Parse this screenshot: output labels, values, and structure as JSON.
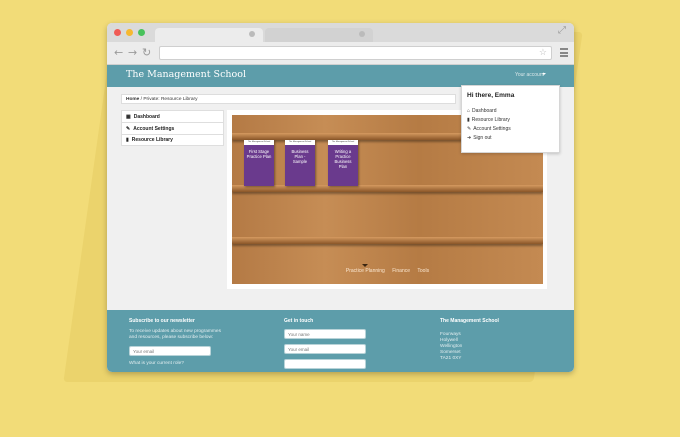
{
  "site": {
    "brand": "The Management School",
    "account_label": "Your account"
  },
  "breadcrumb": {
    "home": "Home",
    "separator": "/",
    "current": "Private: Resource Library"
  },
  "sidebar": {
    "items": [
      {
        "label": "Dashboard",
        "icon": "grid-icon"
      },
      {
        "label": "Account Settings",
        "icon": "wrench-icon"
      },
      {
        "label": "Resource Library",
        "icon": "book-icon"
      }
    ]
  },
  "dropdown": {
    "greeting": "Hi there, Emma",
    "items": [
      {
        "label": "Dashboard",
        "icon": "home-icon"
      },
      {
        "label": "Resource Library",
        "icon": "book-icon"
      },
      {
        "label": "Account Settings",
        "icon": "wrench-icon"
      },
      {
        "label": "Sign out",
        "icon": "signout-icon"
      }
    ]
  },
  "books": [
    {
      "label": "The Management School",
      "title": "First Stage Practice Plan"
    },
    {
      "label": "The Management School",
      "title": "Business Plan - Sample"
    },
    {
      "label": "The Management School",
      "title": "Writing a Practice Business Plan"
    }
  ],
  "categories": [
    "Practice Planning",
    "Finance",
    "Tools"
  ],
  "footer": {
    "newsletter": {
      "heading": "Subscribe to our newsletter",
      "text": "To receive updates about new programmes and resources, please subscribe below:",
      "email_placeholder": "Your email",
      "question": "What is your current role?"
    },
    "contact": {
      "heading": "Get in touch",
      "name_placeholder": "Your name",
      "email_placeholder": "Your email"
    },
    "address": {
      "heading": "The Management School",
      "lines": [
        "Fourways",
        "Holywell",
        "Wellington",
        "Somerset",
        "TA21 0XY"
      ]
    }
  },
  "colors": {
    "background": "#f2dc78",
    "header": "#5d9daa",
    "book": "#6a3a8d"
  }
}
